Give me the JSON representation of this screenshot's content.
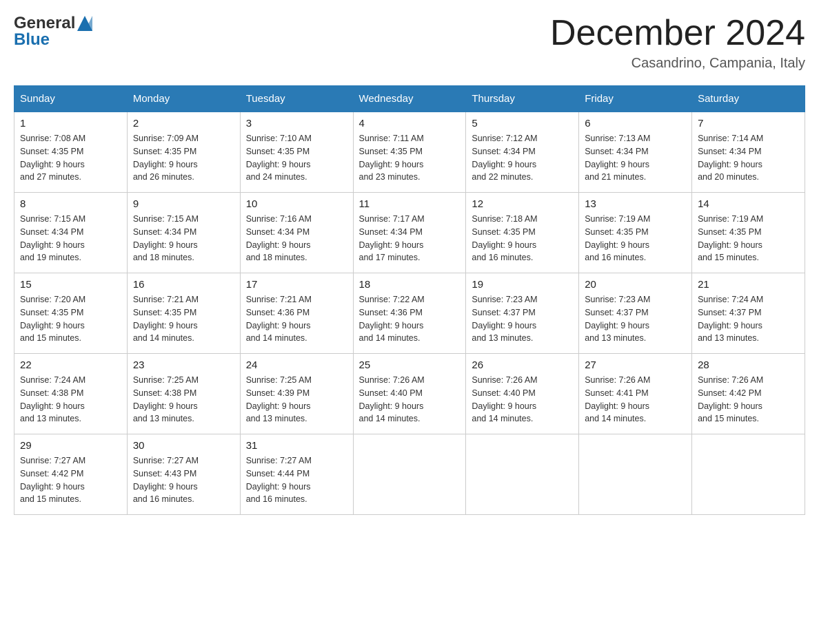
{
  "header": {
    "logo_general": "General",
    "logo_blue": "Blue",
    "month_title": "December 2024",
    "location": "Casandrino, Campania, Italy"
  },
  "weekdays": [
    "Sunday",
    "Monday",
    "Tuesday",
    "Wednesday",
    "Thursday",
    "Friday",
    "Saturday"
  ],
  "weeks": [
    [
      {
        "day": "1",
        "sunrise": "7:08 AM",
        "sunset": "4:35 PM",
        "daylight": "9 hours and 27 minutes."
      },
      {
        "day": "2",
        "sunrise": "7:09 AM",
        "sunset": "4:35 PM",
        "daylight": "9 hours and 26 minutes."
      },
      {
        "day": "3",
        "sunrise": "7:10 AM",
        "sunset": "4:35 PM",
        "daylight": "9 hours and 24 minutes."
      },
      {
        "day": "4",
        "sunrise": "7:11 AM",
        "sunset": "4:35 PM",
        "daylight": "9 hours and 23 minutes."
      },
      {
        "day": "5",
        "sunrise": "7:12 AM",
        "sunset": "4:34 PM",
        "daylight": "9 hours and 22 minutes."
      },
      {
        "day": "6",
        "sunrise": "7:13 AM",
        "sunset": "4:34 PM",
        "daylight": "9 hours and 21 minutes."
      },
      {
        "day": "7",
        "sunrise": "7:14 AM",
        "sunset": "4:34 PM",
        "daylight": "9 hours and 20 minutes."
      }
    ],
    [
      {
        "day": "8",
        "sunrise": "7:15 AM",
        "sunset": "4:34 PM",
        "daylight": "9 hours and 19 minutes."
      },
      {
        "day": "9",
        "sunrise": "7:15 AM",
        "sunset": "4:34 PM",
        "daylight": "9 hours and 18 minutes."
      },
      {
        "day": "10",
        "sunrise": "7:16 AM",
        "sunset": "4:34 PM",
        "daylight": "9 hours and 18 minutes."
      },
      {
        "day": "11",
        "sunrise": "7:17 AM",
        "sunset": "4:34 PM",
        "daylight": "9 hours and 17 minutes."
      },
      {
        "day": "12",
        "sunrise": "7:18 AM",
        "sunset": "4:35 PM",
        "daylight": "9 hours and 16 minutes."
      },
      {
        "day": "13",
        "sunrise": "7:19 AM",
        "sunset": "4:35 PM",
        "daylight": "9 hours and 16 minutes."
      },
      {
        "day": "14",
        "sunrise": "7:19 AM",
        "sunset": "4:35 PM",
        "daylight": "9 hours and 15 minutes."
      }
    ],
    [
      {
        "day": "15",
        "sunrise": "7:20 AM",
        "sunset": "4:35 PM",
        "daylight": "9 hours and 15 minutes."
      },
      {
        "day": "16",
        "sunrise": "7:21 AM",
        "sunset": "4:35 PM",
        "daylight": "9 hours and 14 minutes."
      },
      {
        "day": "17",
        "sunrise": "7:21 AM",
        "sunset": "4:36 PM",
        "daylight": "9 hours and 14 minutes."
      },
      {
        "day": "18",
        "sunrise": "7:22 AM",
        "sunset": "4:36 PM",
        "daylight": "9 hours and 14 minutes."
      },
      {
        "day": "19",
        "sunrise": "7:23 AM",
        "sunset": "4:37 PM",
        "daylight": "9 hours and 13 minutes."
      },
      {
        "day": "20",
        "sunrise": "7:23 AM",
        "sunset": "4:37 PM",
        "daylight": "9 hours and 13 minutes."
      },
      {
        "day": "21",
        "sunrise": "7:24 AM",
        "sunset": "4:37 PM",
        "daylight": "9 hours and 13 minutes."
      }
    ],
    [
      {
        "day": "22",
        "sunrise": "7:24 AM",
        "sunset": "4:38 PM",
        "daylight": "9 hours and 13 minutes."
      },
      {
        "day": "23",
        "sunrise": "7:25 AM",
        "sunset": "4:38 PM",
        "daylight": "9 hours and 13 minutes."
      },
      {
        "day": "24",
        "sunrise": "7:25 AM",
        "sunset": "4:39 PM",
        "daylight": "9 hours and 13 minutes."
      },
      {
        "day": "25",
        "sunrise": "7:26 AM",
        "sunset": "4:40 PM",
        "daylight": "9 hours and 14 minutes."
      },
      {
        "day": "26",
        "sunrise": "7:26 AM",
        "sunset": "4:40 PM",
        "daylight": "9 hours and 14 minutes."
      },
      {
        "day": "27",
        "sunrise": "7:26 AM",
        "sunset": "4:41 PM",
        "daylight": "9 hours and 14 minutes."
      },
      {
        "day": "28",
        "sunrise": "7:26 AM",
        "sunset": "4:42 PM",
        "daylight": "9 hours and 15 minutes."
      }
    ],
    [
      {
        "day": "29",
        "sunrise": "7:27 AM",
        "sunset": "4:42 PM",
        "daylight": "9 hours and 15 minutes."
      },
      {
        "day": "30",
        "sunrise": "7:27 AM",
        "sunset": "4:43 PM",
        "daylight": "9 hours and 16 minutes."
      },
      {
        "day": "31",
        "sunrise": "7:27 AM",
        "sunset": "4:44 PM",
        "daylight": "9 hours and 16 minutes."
      },
      null,
      null,
      null,
      null
    ]
  ],
  "labels": {
    "sunrise": "Sunrise:",
    "sunset": "Sunset:",
    "daylight": "Daylight:"
  }
}
